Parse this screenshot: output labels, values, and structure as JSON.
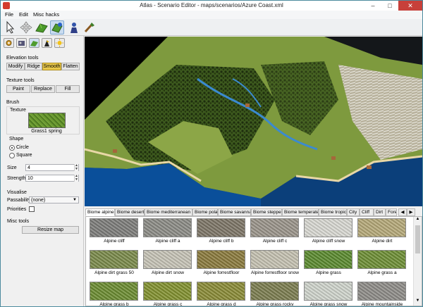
{
  "window": {
    "title": "Atlas - Scenario Editor - maps/scenarios/Azure Coast.xml"
  },
  "menubar": [
    "File",
    "Edit",
    "Misc hacks"
  ],
  "toolbar": {
    "tools": [
      "select-tool-icon",
      "transform-tool-icon",
      "terrain-elevation-icon",
      "paint-terrain-icon",
      "place-unit-icon",
      "brush-icon"
    ]
  },
  "sidebar": {
    "tab_icons": [
      "settings-icon",
      "cinema-icon",
      "terrain-icon",
      "player-icon",
      "environment-icon"
    ],
    "elevation_tools": {
      "heading": "Elevation tools",
      "buttons": [
        "Modify",
        "Ridge",
        "Smooth",
        "Flatten"
      ],
      "selected": "Smooth"
    },
    "texture_tools": {
      "heading": "Texture tools",
      "buttons": [
        "Paint",
        "Replace",
        "Fill"
      ]
    },
    "brush": {
      "heading": "Brush",
      "texture_heading": "Texture",
      "texture_name": "Grass1 spring",
      "shape_heading": "Shape",
      "shapes": [
        "Circle",
        "Square"
      ],
      "selected_shape": "Circle",
      "size_label": "Size",
      "size_value": "4",
      "strength_label": "Strength",
      "strength_value": "10"
    },
    "visualise": {
      "heading": "Visualise",
      "passability_label": "Passability",
      "passability_value": "(none)",
      "priorities_label": "Priorities",
      "priorities_checked": false
    },
    "misc": {
      "heading": "Misc tools",
      "resize_button": "Resize map"
    }
  },
  "biome_tabs": [
    "Biome alpine",
    "Biome desert",
    "Biome mediterranean",
    "Biome polar",
    "Biome savanna",
    "Biome steppe",
    "Biome temperate",
    "Biome tropic",
    "City",
    "Cliff",
    "Dirt",
    "Fore"
  ],
  "active_biome_tab": "Biome alpine",
  "textures": [
    [
      "Alpine cliff",
      "Alpine cliff a",
      "Alpine cliff b",
      "Alpine cliff c",
      "Alpine cliff snow",
      "Alpine dirt"
    ],
    [
      "Alpine dirt grass 50",
      "Alpine dirt snow",
      "Alpine forrestfloor",
      "Alpine forrestfloor snow",
      "Alpine grass",
      "Alpine grass a"
    ],
    [
      "Alpine grass b",
      "Alpine grass c",
      "Alpine grass d",
      "Alpine grass rocky",
      "Alpine grass snow",
      "Alpine mountainside"
    ]
  ],
  "texture_colors": [
    [
      "#7c7c7a",
      "#8b8b85",
      "#7d7566",
      "#9a948a",
      "#d8d8d2",
      "#b5a878"
    ],
    [
      "#7a8a4a",
      "#c6c3b6",
      "#8a7a3c",
      "#c5c1b1",
      "#5a8a2e",
      "#6d8e34"
    ],
    [
      "#6b8c31",
      "#82912f",
      "#8a8b36",
      "#7b7d4f",
      "#cfd4cc",
      "#8e8c88"
    ]
  ]
}
